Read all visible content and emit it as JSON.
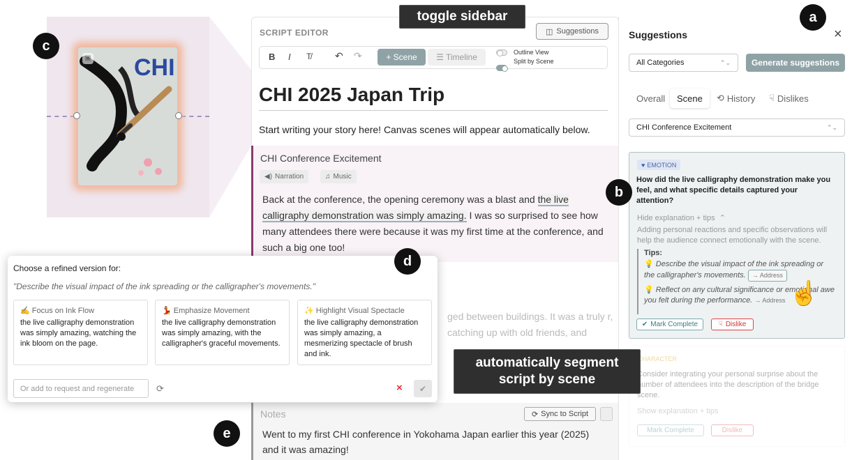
{
  "labels": {
    "toggle_sidebar": "toggle sidebar",
    "auto_segment_line1": "automatically segment",
    "auto_segment_line2": "script by scene"
  },
  "badges": {
    "a": "a",
    "b": "b",
    "c": "c",
    "d": "d",
    "e": "e"
  },
  "image_panel": {
    "image_text": "CHI"
  },
  "editor": {
    "header": "SCRIPT EDITOR",
    "suggestions_button": "Suggestions",
    "toolbar": {
      "bold": "B",
      "italic": "I",
      "clear_format": "T̸",
      "undo": "↶",
      "redo": "↷",
      "scene_button": "+ Scene",
      "timeline_button": "☰ Timeline",
      "outline_view": "Outline View",
      "split_by_scene": "Split by Scene"
    },
    "title": "CHI 2025 Japan Trip",
    "intro": "Start writing your story here! Canvas scenes will appear automatically below.",
    "scene": {
      "title": "CHI Conference Excitement",
      "narration": "Narration",
      "music": "Music",
      "text_before": "Back at the conference, the opening ceremony was a blast and ",
      "text_highlight": "the live calligraphy demonstration was simply amazing.",
      "text_after": " I was so surprised to see how many attendees there were because it was my first time at the conference, and such a big one too!"
    },
    "faded_text": "ged between buildings. It was a truly r, catching up with old friends, and",
    "notes": {
      "label": "Notes",
      "sync_button": "Sync to Script",
      "text": "Went to my first CHI conference in Yokohama Japan earlier this year (2025) and it was amazing!"
    }
  },
  "popup": {
    "title": "Choose a refined version for:",
    "quote": "\"Describe the visual impact of the ink spreading or the calligrapher's movements.\"",
    "cards": [
      {
        "title": "✍ Focus on Ink Flow",
        "text": "the live calligraphy demonstration was simply amazing, watching the ink bloom on the page."
      },
      {
        "title": "💃 Emphasize Movement",
        "text": "the live calligraphy demonstration was simply amazing, with the calligrapher's graceful movements."
      },
      {
        "title": "✨ Highlight Visual Spectacle",
        "text": "the live calligraphy demonstration was simply amazing, a mesmerizing spectacle of brush and ink."
      }
    ],
    "input_placeholder": "Or add to request and regenerate",
    "refresh": "⟳",
    "close": "×",
    "confirm": "✔"
  },
  "sidebar": {
    "title": "Suggestions",
    "close": "×",
    "category_select": "All Categories",
    "generate_button": "Generate suggestions",
    "tabs": {
      "overall": "Overall",
      "scene": "Scene",
      "history": "History",
      "dislikes": "Dislikes"
    },
    "scene_select": "CHI Conference Excitement",
    "card1": {
      "badge": "EMOTION",
      "question": "How did the live calligraphy demonstration make you feel, and what specific details captured your attention?",
      "hide_explanation": "Hide explanation + tips",
      "explanation": "Adding personal reactions and specific observations will help the audience connect emotionally with the scene.",
      "tips_label": "Tips:",
      "tip1": "Describe the visual impact of the ink spreading or the calligrapher's movements.",
      "tip2": "Reflect on any cultural significance or emotional awe you felt during the performance.",
      "address": "→ Address",
      "address2": "→ Address",
      "mark_complete": "Mark Complete",
      "dislike": "Dislike"
    },
    "card2": {
      "badge": "CHARACTER",
      "text": "Consider integrating your personal surprise about the number of attendees into the description of the bridge scene.",
      "show_explanation": "Show explanation + tips",
      "mark_complete": "Mark Complete",
      "dislike": "Dislike"
    }
  }
}
